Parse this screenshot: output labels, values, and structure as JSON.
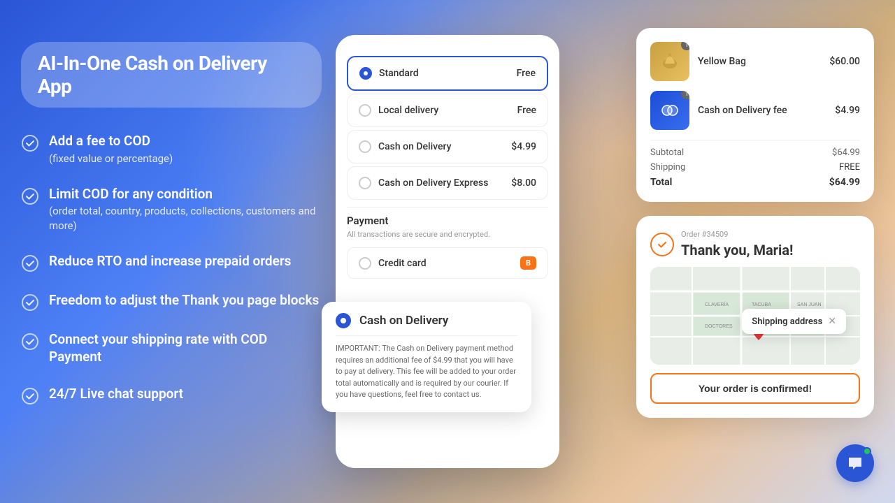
{
  "hero": {
    "title": "AI-In-One Cash on Delivery App"
  },
  "features": [
    {
      "id": "fee",
      "main": "Add a fee to COD",
      "sub": "(fixed value or percentage)"
    },
    {
      "id": "limit",
      "main": "Limit COD for any condition",
      "sub": "(order total, country, products, collections, customers and more)"
    },
    {
      "id": "rto",
      "main": "Reduce RTO and increase prepaid orders",
      "sub": ""
    },
    {
      "id": "thankyou",
      "main": "Freedom to adjust the Thank you page blocks",
      "sub": ""
    },
    {
      "id": "shipping",
      "main": "Connect your shipping rate with COD Payment",
      "sub": ""
    },
    {
      "id": "support",
      "main": "24/7 Live chat support",
      "sub": ""
    }
  ],
  "shipping_options": [
    {
      "id": "standard",
      "label": "Standard",
      "price": "Free",
      "selected": true
    },
    {
      "id": "local",
      "label": "Local delivery",
      "price": "Free",
      "selected": false
    },
    {
      "id": "cod",
      "label": "Cash on Delivery",
      "price": "$4.99",
      "selected": false
    },
    {
      "id": "cod_express",
      "label": "Cash on Delivery Express",
      "price": "$8.00",
      "selected": false
    }
  ],
  "payment": {
    "title": "Payment",
    "subtitle": "All transactions are secure and encrypted.",
    "credit_card_label": "Credit card"
  },
  "cod_float": {
    "label": "Cash on Delivery",
    "note": "IMPORTANT: The Cash on Delivery payment method requires an additional fee of $4.99 that you will have to pay at delivery. This fee will be added to your order total automatically and is required by our courier. If you have questions, feel free to contact us."
  },
  "order_summary": {
    "items": [
      {
        "name": "Yellow Bag",
        "price": "$60.00",
        "type": "yellow"
      },
      {
        "name": "Cash on Delivery fee",
        "price": "$4.99",
        "type": "blue"
      }
    ],
    "subtotal_label": "Subtotal",
    "subtotal_value": "$64.99",
    "shipping_label": "Shipping",
    "shipping_value": "FREE",
    "total_label": "Total",
    "total_value": "$64.99"
  },
  "thankyou": {
    "order_number": "Order #34509",
    "title": "Thank you, Maria!",
    "shipping_address_label": "Shipping address",
    "confirmed_label": "Your order is confirmed!"
  },
  "chat": {
    "aria": "Live chat support"
  }
}
